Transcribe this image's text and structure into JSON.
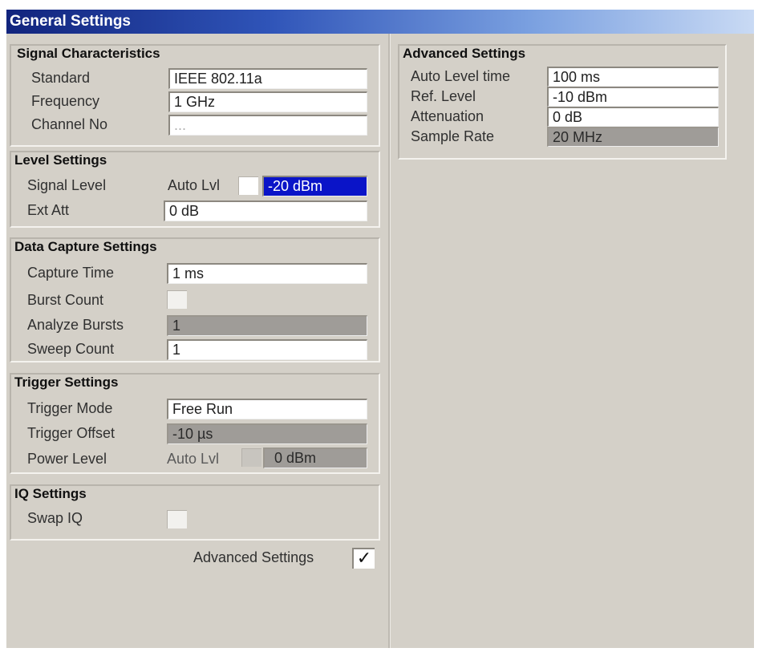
{
  "window": {
    "title": "General Settings"
  },
  "signal_characteristics": {
    "title": "Signal Characteristics",
    "standard_label": "Standard",
    "standard_value": "IEEE 802.11a",
    "frequency_label": "Frequency",
    "frequency_value": "1 GHz",
    "channel_label": "Channel No",
    "channel_value": "..."
  },
  "level_settings": {
    "title": "Level Settings",
    "signal_level_label": "Signal Level",
    "auto_lvl_label": "Auto Lvl",
    "signal_level_value": "-20 dBm",
    "ext_att_label": "Ext Att",
    "ext_att_value": "0 dB"
  },
  "data_capture": {
    "title": "Data Capture Settings",
    "capture_time_label": "Capture Time",
    "capture_time_value": "1 ms",
    "burst_count_label": "Burst Count",
    "analyze_bursts_label": "Analyze Bursts",
    "analyze_bursts_value": "1",
    "sweep_count_label": "Sweep Count",
    "sweep_count_value": "1"
  },
  "trigger_settings": {
    "title": "Trigger Settings",
    "trigger_mode_label": "Trigger Mode",
    "trigger_mode_value": "Free Run",
    "trigger_offset_label": "Trigger Offset",
    "trigger_offset_value": "-10 µs",
    "power_level_label": "Power Level",
    "auto_lvl_label": "Auto Lvl",
    "power_level_value": "0 dBm"
  },
  "iq_settings": {
    "title": "IQ Settings",
    "swap_iq_label": "Swap IQ"
  },
  "advanced_toggle": {
    "label": "Advanced Settings",
    "checked": true,
    "check_glyph": "✓"
  },
  "advanced_settings": {
    "title": "Advanced Settings",
    "auto_level_time_label": "Auto Level time",
    "auto_level_time_value": "100 ms",
    "ref_level_label": "Ref. Level",
    "ref_level_value": "-10 dBm",
    "attenuation_label": "Attenuation",
    "attenuation_value": "0 dB",
    "sample_rate_label": "Sample Rate",
    "sample_rate_value": "20 MHz"
  },
  "colors": {
    "title_gradient_start": "#11247d",
    "dialog_background": "#d4d0c8",
    "disabled_field": "#9f9c98",
    "selected_field": "#0a14c8"
  }
}
